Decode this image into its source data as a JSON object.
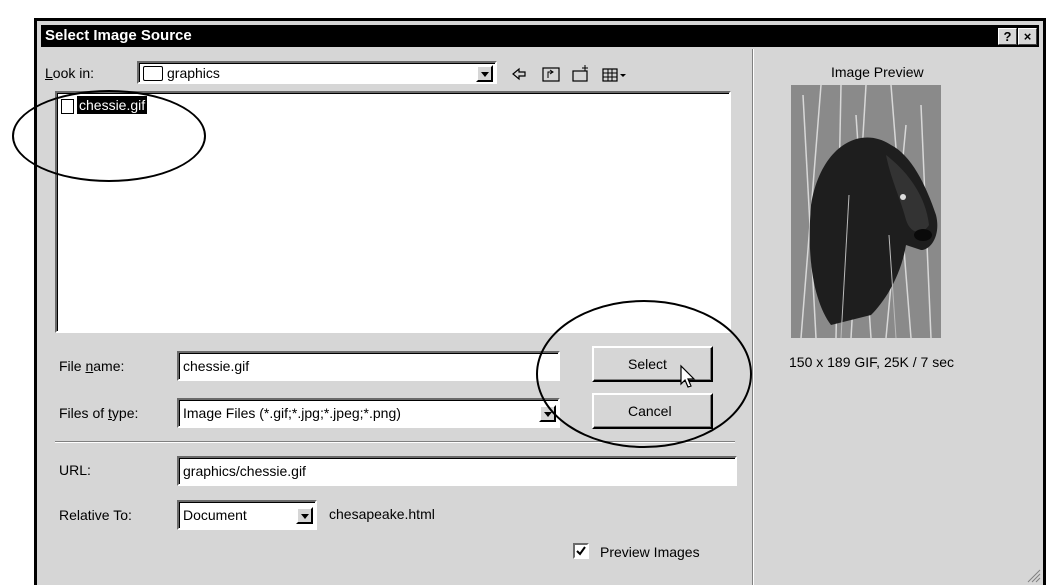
{
  "dialog": {
    "title": "Select Image Source",
    "help_btn": "?",
    "close_btn": "×"
  },
  "lookin": {
    "label": "Look in:",
    "value": "graphics"
  },
  "toolbar": {
    "icons": [
      "back-icon",
      "up-folder-icon",
      "new-folder-icon",
      "view-menu-icon"
    ]
  },
  "files": [
    {
      "name": "chessie.gif",
      "selected": true
    }
  ],
  "filename": {
    "label": "File name:",
    "value": "chessie.gif"
  },
  "filetype": {
    "label": "Files of type:",
    "value": "Image Files (*.gif;*.jpg;*.jpeg;*.png)"
  },
  "buttons": {
    "select": "Select",
    "cancel": "Cancel"
  },
  "url": {
    "label": "URL:",
    "value": "graphics/chessie.gif"
  },
  "relative": {
    "label": "Relative To:",
    "value": "Document",
    "file": "chesapeake.html"
  },
  "preview_images": {
    "label": "Preview Images",
    "checked": true
  },
  "preview": {
    "title": "Image Preview",
    "info": "150 x 189 GIF, 25K / 7 sec"
  }
}
